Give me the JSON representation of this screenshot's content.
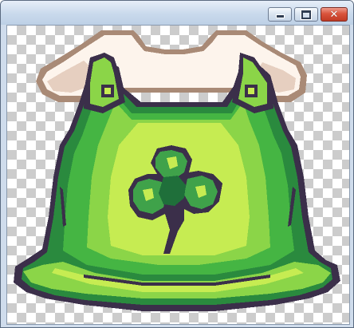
{
  "window": {
    "title": "",
    "controls": {
      "minimize_glyph": "–",
      "maximize_glyph": "□",
      "close_glyph": "✕"
    }
  },
  "canvas": {
    "background": "transparency-checkerboard",
    "image": "pixel-art-green-overalls-with-shamrock",
    "colors": {
      "outline": "#3b2f4a",
      "shirt": "#fdf4ec",
      "shirt_shadow": "#e6cfc0",
      "shirt_outline": "#a98a76",
      "green_dark": "#2a8a3e",
      "green_mid": "#45b543",
      "green_light": "#8bd548",
      "green_bright": "#c6ec52",
      "shamrock_dark": "#1f6f3a",
      "shamrock_mid": "#3fa24a",
      "checker_light": "#ffffff",
      "checker_dark": "#cccccc"
    }
  }
}
